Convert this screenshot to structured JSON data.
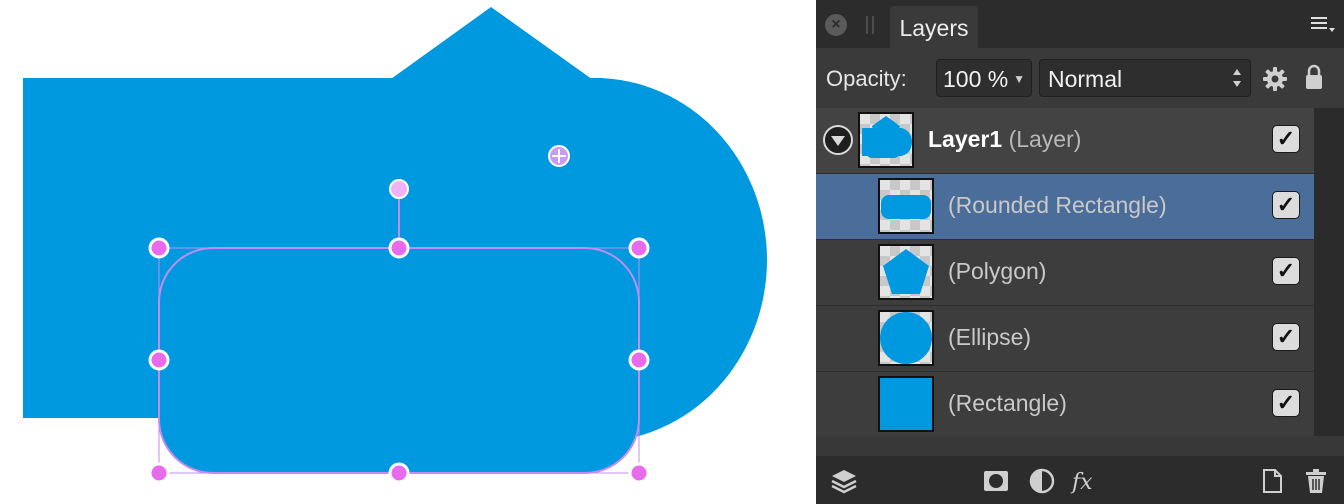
{
  "panel": {
    "tab_title": "Layers",
    "opacity_label": "Opacity:",
    "opacity_value": "100 %",
    "blend_mode": "Normal"
  },
  "layers": [
    {
      "name": "Layer1",
      "type": "(Layer)",
      "checked": "✓"
    },
    {
      "name": "(Rounded Rectangle)",
      "checked": "✓",
      "selected": true
    },
    {
      "name": "(Polygon)",
      "checked": "✓"
    },
    {
      "name": "(Ellipse)",
      "checked": "✓"
    },
    {
      "name": "(Rectangle)",
      "checked": "✓"
    }
  ],
  "icons": {
    "close": "close-icon",
    "menu": "panel-menu-icon",
    "gear": "gear-icon",
    "lock": "lock-icon",
    "expander": "expand-triangle-icon",
    "layers_stack": "layers-stack-icon",
    "mask": "mask-icon",
    "adjustment": "adjustment-icon",
    "fx": "fx-icon",
    "new_layer": "new-layer-icon",
    "delete": "trash-icon"
  },
  "colors": {
    "shape_fill": "#0099e0",
    "selection": "#c38cf2",
    "handle": "#e86bec",
    "selected_row": "#4a6d99"
  }
}
